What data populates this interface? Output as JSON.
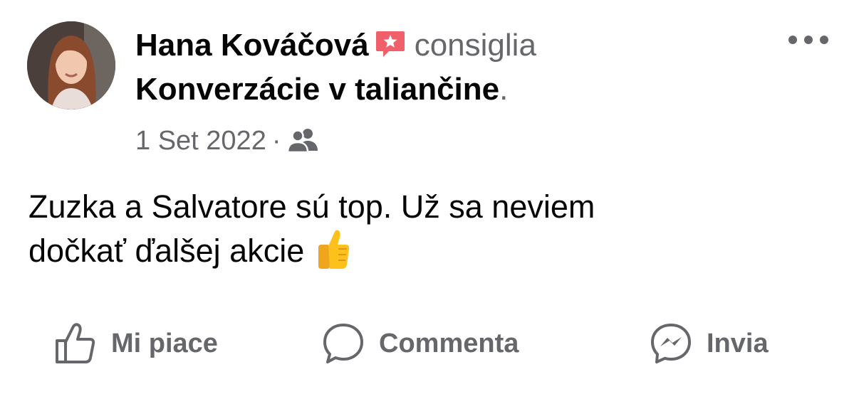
{
  "post": {
    "author": "Hana Kováčová",
    "verb": "consiglia",
    "group": "Konverzácie v taliančine",
    "group_suffix": ".",
    "date": "1 Set 2022",
    "separator": "·",
    "audience_icon": "group-audience-icon",
    "text_line1": "Zuzka a Salvatore sú top. Už sa neviem",
    "text_line2": "dočkať ďalšej akcie",
    "emoji": "thumbs-up-emoji"
  },
  "actions": {
    "like": "Mi piace",
    "comment": "Commenta",
    "send": "Invia"
  },
  "colors": {
    "primary_text": "#050505",
    "secondary_text": "#65676b",
    "badge": "#f0606b",
    "background": "#ffffff"
  }
}
